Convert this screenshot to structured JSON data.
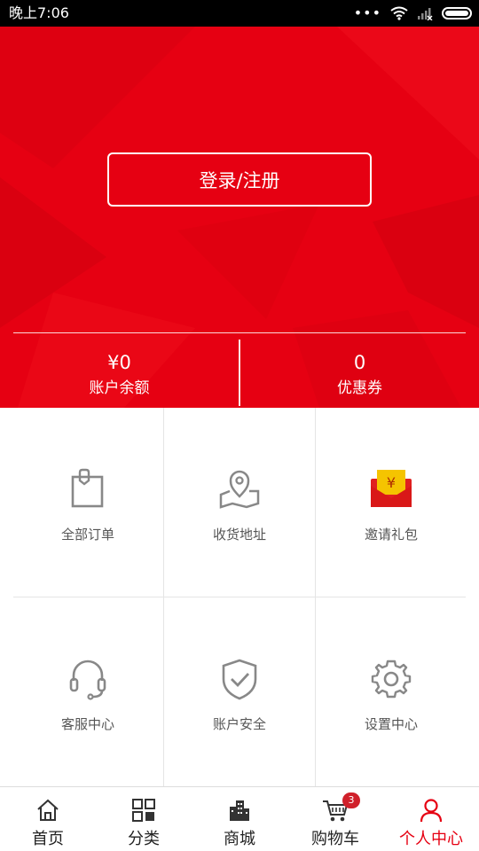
{
  "status_bar": {
    "time": "晚上7:06",
    "dots": "•••"
  },
  "hero": {
    "login_label": "登录/注册",
    "balance_value": "¥0",
    "balance_label": "账户余额",
    "coupon_value": "0",
    "coupon_label": "优惠券"
  },
  "grid": {
    "items": [
      {
        "label": "全部订单",
        "icon": "shopping-bag-icon"
      },
      {
        "label": "收货地址",
        "icon": "map-pin-icon"
      },
      {
        "label": "邀请礼包",
        "icon": "red-envelope-icon"
      },
      {
        "label": "客服中心",
        "icon": "headset-icon"
      },
      {
        "label": "账户安全",
        "icon": "shield-check-icon"
      },
      {
        "label": "设置中心",
        "icon": "gear-icon"
      }
    ]
  },
  "tabbar": {
    "tabs": [
      {
        "label": "首页",
        "icon": "home-icon"
      },
      {
        "label": "分类",
        "icon": "category-grid-icon"
      },
      {
        "label": "商城",
        "icon": "buildings-icon"
      },
      {
        "label": "购物车",
        "icon": "cart-icon",
        "badge": "3"
      },
      {
        "label": "个人中心",
        "icon": "user-icon",
        "active": true
      }
    ]
  },
  "colors": {
    "brand_red": "#e60012",
    "icon_gray": "#888888",
    "badge_red": "#d0202a"
  }
}
